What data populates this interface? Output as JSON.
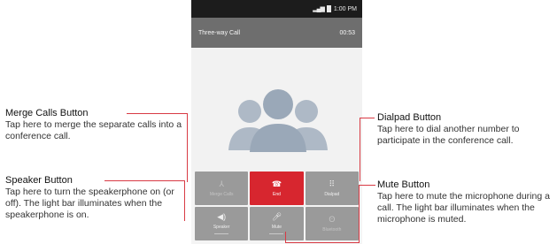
{
  "phone": {
    "status_time": "1:00 PM",
    "call_title": "Three-way Call",
    "call_timer": "00:53",
    "buttons": {
      "merge_calls": "Merge Calls",
      "end": "End",
      "dialpad": "Dialpad",
      "speaker": "Speaker",
      "mute": "Mute",
      "bluetooth": "Bluetooth"
    }
  },
  "callouts": {
    "merge": {
      "title": "Merge Calls Button",
      "desc": "Tap here to merge the separate calls into a conference call."
    },
    "speaker": {
      "title": "Speaker Button",
      "desc": "Tap here to turn the speakerphone on (or off). The light bar illuminates when the speakerphone is on."
    },
    "dialpad": {
      "title": "Dialpad Button",
      "desc": "Tap here to dial another number to participate in the conference call."
    },
    "mute": {
      "title": "Mute Button",
      "desc": "Tap here to mute the microphone during a call. The light bar illuminates when the microphone is muted."
    }
  },
  "colors": {
    "callout_line": "#d83a44",
    "end_button": "#d7262f",
    "avatar": "#aeb9c6"
  },
  "icons": [
    "signal-icon",
    "battery-icon",
    "conference-avatar-icon",
    "merge-icon",
    "end-call-icon",
    "dialpad-icon",
    "speaker-icon",
    "mute-icon",
    "bluetooth-icon"
  ]
}
